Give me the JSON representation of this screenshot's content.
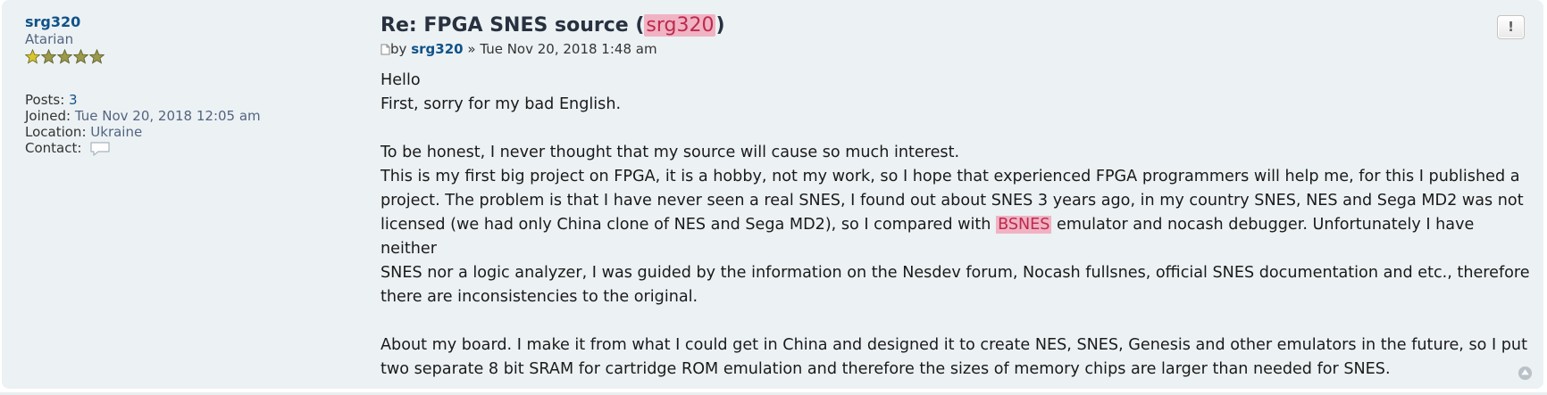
{
  "profile": {
    "username": "srg320",
    "rank": "Atarian",
    "stars_filled": 5,
    "posts_label": "Posts:",
    "posts_value": "3",
    "joined_label": "Joined:",
    "joined_value": "Tue Nov 20, 2018 12:05 am",
    "location_label": "Location:",
    "location_value": "Ukraine",
    "contact_label": "Contact:",
    "contact_icon": "speech-bubble-icon"
  },
  "post": {
    "title_prefix": "Re: FPGA SNES source (",
    "title_highlight": "srg320",
    "title_suffix": ")",
    "by_label": "by",
    "author": "srg320",
    "date_sep": "»",
    "date": "Tue Nov 20, 2018 1:48 am",
    "paragraphs": {
      "p1_line1": "Hello",
      "p1_line2": "First, sorry for my bad English.",
      "p2_line1": "To be honest, I never thought that my source will cause so much interest.",
      "p2_line2": "This is my first big project on FPGA, it is a hobby, not my work, so I hope that experienced FPGA programmers will help me, for this I published a",
      "p2_line3": "project. The problem is that I have never seen a real SNES, I found out about SNES 3 years ago, in my country SNES, NES and Sega MD2 was not",
      "p2_line4_a": "licensed (we had only China clone of NES and Sega MD2), so I compared with",
      "p2_line4_hl": "BSNES",
      "p2_line4_b": "emulator and nocash debugger. Unfortunately I have neither",
      "p2_line5": "SNES nor a logic analyzer, I was guided by the information on the Nesdev forum, Nocash fullsnes, official SNES documentation and etc., therefore",
      "p2_line6": "there are inconsistencies to the original.",
      "p3_line1": "About my board. I make it from what I could get in China and designed it to create NES, SNES, Genesis and other emulators in the future, so I put",
      "p3_line2": "two separate 8 bit SRAM for cartridge ROM emulation and therefore the sizes of memory chips are larger than needed for SNES."
    }
  },
  "buttons": {
    "report_label": "!",
    "report_icon": "report-exclamation-icon",
    "top_icon": "back-to-top-icon"
  },
  "colors": {
    "background": "#ecf1f3",
    "link": "#105289",
    "highlight_bg": "#f0b3c3",
    "highlight_text": "#bc2a4d",
    "star": "#c8b61a"
  }
}
